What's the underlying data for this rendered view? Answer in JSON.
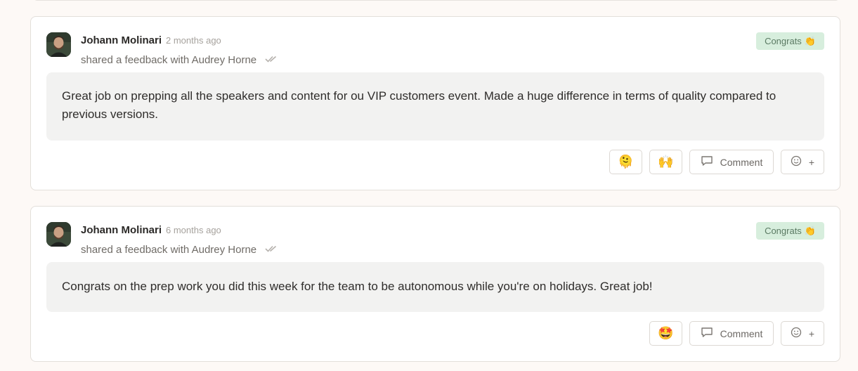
{
  "feed": [
    {
      "author": "Johann Molinari",
      "time": "2 months ago",
      "shared": "shared a feedback with Audrey Horne",
      "badge_label": "Congrats",
      "badge_emoji": "👏",
      "message": "Great job on prepping all the speakers and content for ou VIP customers event. Made a huge difference in terms of quality compared to previous versions.",
      "reactions": [
        "🫠",
        "🙌"
      ],
      "comment_label": "Comment",
      "add_reaction_label": "+"
    },
    {
      "author": "Johann Molinari",
      "time": "6 months ago",
      "shared": "shared a feedback with Audrey Horne",
      "badge_label": "Congrats",
      "badge_emoji": "👏",
      "message": "Congrats on the prep work you did this week for the team to be autonomous while you're on holidays. Great job!",
      "reactions": [
        "🤩"
      ],
      "comment_label": "Comment",
      "add_reaction_label": "+"
    }
  ],
  "colors": {
    "badge_bg": "#d7eedd",
    "badge_text": "#5b7a63",
    "message_bg": "#f2f2f1",
    "page_bg": "#fdf9f6"
  }
}
